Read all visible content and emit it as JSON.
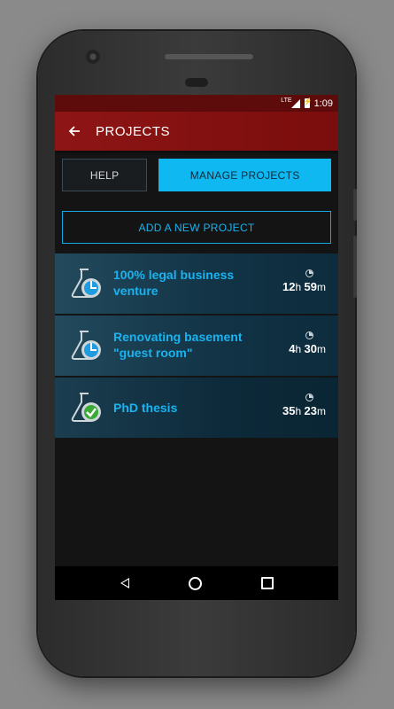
{
  "status_bar": {
    "network": "LTE",
    "time": "1:09"
  },
  "app_bar": {
    "title": "PROJECTS"
  },
  "tabs": [
    {
      "label": "HELP",
      "selected": false
    },
    {
      "label": "MANAGE PROJECTS",
      "selected": true
    }
  ],
  "add_button": {
    "label": "ADD A NEW PROJECT"
  },
  "projects": [
    {
      "name": "100% legal business venture",
      "hours": "12",
      "minutes": "59",
      "status_icon": "in-progress-gear-icon"
    },
    {
      "name": "Renovating basement \"guest room\"",
      "hours": "4",
      "minutes": "30",
      "status_icon": "in-progress-gear-icon"
    },
    {
      "name": "PhD thesis",
      "hours": "35",
      "minutes": "23",
      "status_icon": "completed-check-gear-icon"
    }
  ],
  "time_units": {
    "hours": "h",
    "minutes": "m"
  },
  "colors": {
    "app_bar": "#8e1515",
    "accent": "#18b3f0",
    "row_background": "#123446",
    "completed": "#3aa935"
  }
}
